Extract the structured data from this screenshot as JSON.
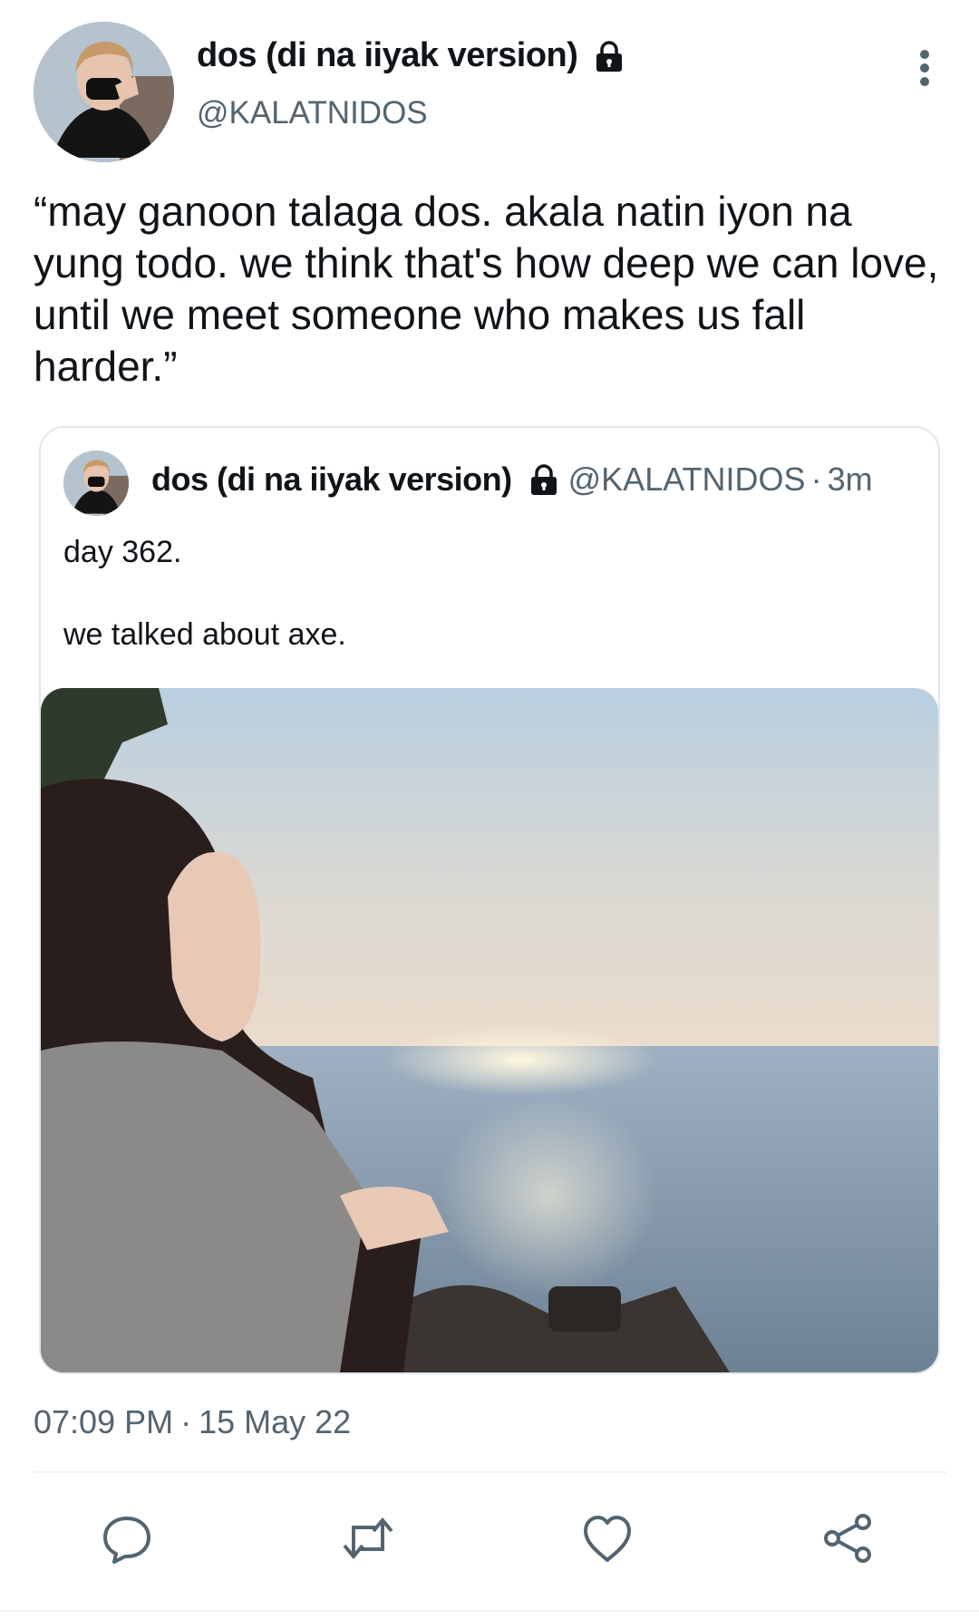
{
  "author": {
    "display_name": "dos (di na iiyak version)",
    "handle": "@KALATNIDOS",
    "protected_icon": "lock-icon"
  },
  "tweet": {
    "text": "“may ganoon talaga dos. akala natin iyon na yung todo. we think that's how deep we can love, until we meet someone who makes us fall harder.”",
    "time": "07:09 PM",
    "separator": "·",
    "date": "15 May 22"
  },
  "quoted": {
    "display_name": "dos (di na iiyak version)",
    "handle": "@KALATNIDOS",
    "separator": "·",
    "time_ago": "3m",
    "line1": "day 362.",
    "line2": "we talked about axe."
  },
  "actions": [
    {
      "icon": "reply-icon"
    },
    {
      "icon": "retweet-icon"
    },
    {
      "icon": "like-icon"
    },
    {
      "icon": "share-icon"
    }
  ],
  "colors": {
    "text_primary": "#0f1419",
    "text_secondary": "#536471",
    "border": "#e1e6ea",
    "icon": "#536471"
  }
}
